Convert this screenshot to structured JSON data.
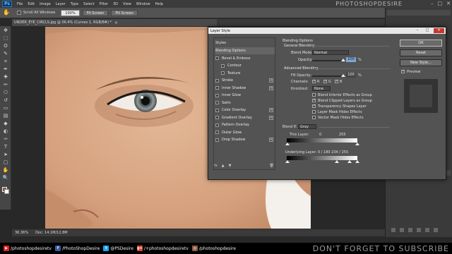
{
  "app": {
    "logo": "Ps",
    "menu": [
      "File",
      "Edit",
      "Image",
      "Layer",
      "Type",
      "Select",
      "Filter",
      "3D",
      "View",
      "Window",
      "Help"
    ],
    "watermark": "PHOTOSHOPDESIRE",
    "window_controls": [
      "–",
      "□",
      "✕"
    ]
  },
  "options_bar": {
    "tool_icon": "hand-icon",
    "scroll_all_label": "Scroll All Windows",
    "zoom_value": "100%",
    "fit_screen": "Fit Screen",
    "fill_screen": "Fill Screen"
  },
  "tools": [
    "move-icon",
    "marquee-icon",
    "lasso-icon",
    "quick-select-icon",
    "crop-icon",
    "eyedropper-icon",
    "healing-icon",
    "brush-icon",
    "stamp-icon",
    "history-brush-icon",
    "eraser-icon",
    "gradient-icon",
    "blur-icon",
    "dodge-icon",
    "pen-icon",
    "type-icon",
    "path-select-icon",
    "shape-icon",
    "hand-icon",
    "zoom-icon"
  ],
  "tool_glyphs": [
    "✥",
    "⬚",
    "ʘ",
    "✎",
    "⌗",
    "✒",
    "✚",
    "✏",
    "⎔",
    "↺",
    "▭",
    "▤",
    "◆",
    "◐",
    "✑",
    "T",
    "➤",
    "▢",
    "✋",
    "🔍"
  ],
  "colors": {
    "foreground": "#8b5a3c",
    "background": "#ffffff",
    "accent": "#2d77b7"
  },
  "document": {
    "tab_title": "UNDER_EYE_CIRCLS.jpg @ 36.4% (Curves 1, RGB/8#) *",
    "zoom": "36.36%",
    "doc_size": "Doc: 14.1M/12.8M"
  },
  "dialog": {
    "title": "Layer Style",
    "styles_header": "Styles",
    "styles": [
      {
        "label": "Blending Options",
        "selected": true,
        "check": false,
        "plus": false,
        "indent": false
      },
      {
        "label": "Bevel & Emboss",
        "selected": false,
        "check": true,
        "plus": false,
        "indent": false
      },
      {
        "label": "Contour",
        "selected": false,
        "check": true,
        "plus": false,
        "indent": true
      },
      {
        "label": "Texture",
        "selected": false,
        "check": true,
        "plus": false,
        "indent": true
      },
      {
        "label": "Stroke",
        "selected": false,
        "check": true,
        "plus": true,
        "indent": false
      },
      {
        "label": "Inner Shadow",
        "selected": false,
        "check": true,
        "plus": true,
        "indent": false
      },
      {
        "label": "Inner Glow",
        "selected": false,
        "check": true,
        "plus": false,
        "indent": false
      },
      {
        "label": "Satin",
        "selected": false,
        "check": true,
        "plus": false,
        "indent": false
      },
      {
        "label": "Color Overlay",
        "selected": false,
        "check": true,
        "plus": true,
        "indent": false
      },
      {
        "label": "Gradient Overlay",
        "selected": false,
        "check": true,
        "plus": true,
        "indent": false
      },
      {
        "label": "Pattern Overlay",
        "selected": false,
        "check": true,
        "plus": false,
        "indent": false
      },
      {
        "label": "Outer Glow",
        "selected": false,
        "check": true,
        "plus": false,
        "indent": false
      },
      {
        "label": "Drop Shadow",
        "selected": false,
        "check": true,
        "plus": true,
        "indent": false
      }
    ],
    "fx_bar": [
      "fx",
      "▲",
      "▼",
      "🗑"
    ],
    "blending_options": "Blending Options",
    "general_blending": "General Blending",
    "blend_mode_label": "Blend Mode:",
    "blend_mode_value": "Normal",
    "opacity_label": "Opacity:",
    "opacity_value": "100",
    "opacity_unit": "%",
    "advanced_blending": "Advanced Blending",
    "fill_opacity_label": "Fill Opacity:",
    "fill_opacity_value": "100",
    "channels_label": "Channels:",
    "channels": [
      "R",
      "G",
      "B"
    ],
    "knockout_label": "Knockout:",
    "knockout_value": "None",
    "adv_checks": [
      {
        "label": "Blend Interior Effects as Group",
        "on": false
      },
      {
        "label": "Blend Clipped Layers as Group",
        "on": true
      },
      {
        "label": "Transparency Shapes Layer",
        "on": true
      },
      {
        "label": "Layer Mask Hides Effects",
        "on": false
      },
      {
        "label": "Vector Mask Hides Effects",
        "on": false
      }
    ],
    "blend_if_label": "Blend If:",
    "blend_if_value": "Gray",
    "this_layer_label": "This Layer:",
    "this_layer_low": "0",
    "this_layer_high": "255",
    "underlying_label": "Underlying Layer:",
    "underlying_values": "0 / 180   234 / 255",
    "buttons": {
      "ok": "OK",
      "reset": "Reset",
      "new_style": "New Style...",
      "preview": "Preview"
    },
    "preview_checked": true
  },
  "social": [
    {
      "icon": "youtube-icon",
      "glyph": "▶",
      "color": "#d22",
      "text": "/photoshopdesiretv"
    },
    {
      "icon": "facebook-icon",
      "glyph": "f",
      "color": "#3b5998",
      "text": "/PhotoShopDesire"
    },
    {
      "icon": "twitter-icon",
      "glyph": "t",
      "color": "#1da1f2",
      "text": "@PSDesire"
    },
    {
      "icon": "googleplus-icon",
      "glyph": "g+",
      "color": "#d34836",
      "text": "/+photoshopdesiretv"
    },
    {
      "icon": "instagram-icon",
      "glyph": "◎",
      "color": "#8a5a44",
      "text": "/photoshopdesire"
    }
  ],
  "subscribe_text": "DON'T FORGET TO SUBSCRIBE"
}
